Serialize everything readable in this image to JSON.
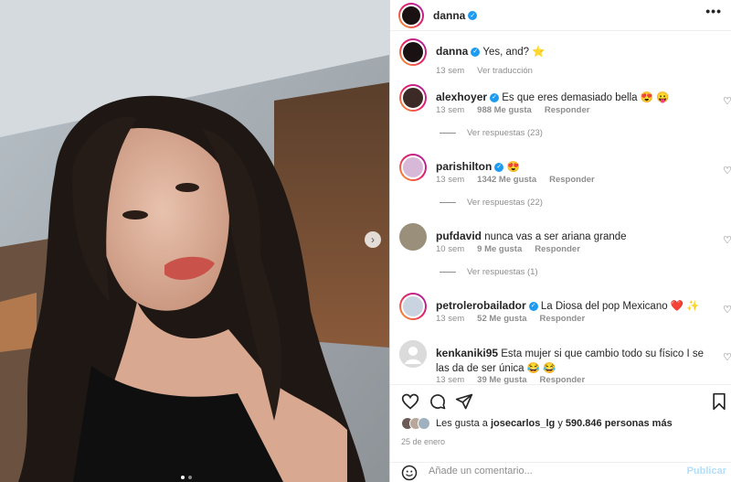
{
  "post": {
    "username": "danna",
    "caption": "Yes, and? ⭐",
    "caption_time": "13 sem",
    "see_translation": "Ver traducción"
  },
  "comments": [
    {
      "user": "alexhoyer",
      "verified": true,
      "text": "Es que eres demasiado bella 😍 😛",
      "time": "13 sem",
      "likes": "988 Me gusta",
      "reply": "Responder",
      "replies": "Ver respuestas (23)"
    },
    {
      "user": "parishilton",
      "verified": true,
      "text": "😍",
      "time": "13 sem",
      "likes": "1342 Me gusta",
      "reply": "Responder",
      "replies": "Ver respuestas (22)"
    },
    {
      "user": "pufdavid",
      "verified": false,
      "text": "nunca vas a ser ariana grande",
      "time": "10 sem",
      "likes": "9 Me gusta",
      "reply": "Responder",
      "replies": "Ver respuestas (1)"
    },
    {
      "user": "petrolerobailador",
      "verified": true,
      "text": "La Diosa del pop Mexicano ❤️ ✨",
      "time": "13 sem",
      "likes": "52 Me gusta",
      "reply": "Responder"
    },
    {
      "user": "kenkaniki95",
      "verified": false,
      "text": "Esta mujer si que cambio todo su físico I se las da de ser única 😂 😂",
      "time": "13 sem",
      "likes": "39 Me gusta",
      "reply": "Responder"
    }
  ],
  "likes_line": {
    "prefix": "Les gusta a",
    "user": "josecarlos_lg",
    "and": "y",
    "count": "590.846 personas más"
  },
  "date": "25 de enero",
  "add_comment": {
    "placeholder": "Añade un comentario...",
    "publish": "Publicar"
  },
  "icons": [
    "more-icon",
    "heart-icon",
    "comment-icon",
    "share-icon",
    "bookmark-icon",
    "emoji-icon",
    "chevron-right-icon",
    "verified-icon"
  ],
  "colors": {
    "verified": "#1d9bf0",
    "publish": "#b2dffc",
    "meta": "#8e8e8e"
  }
}
